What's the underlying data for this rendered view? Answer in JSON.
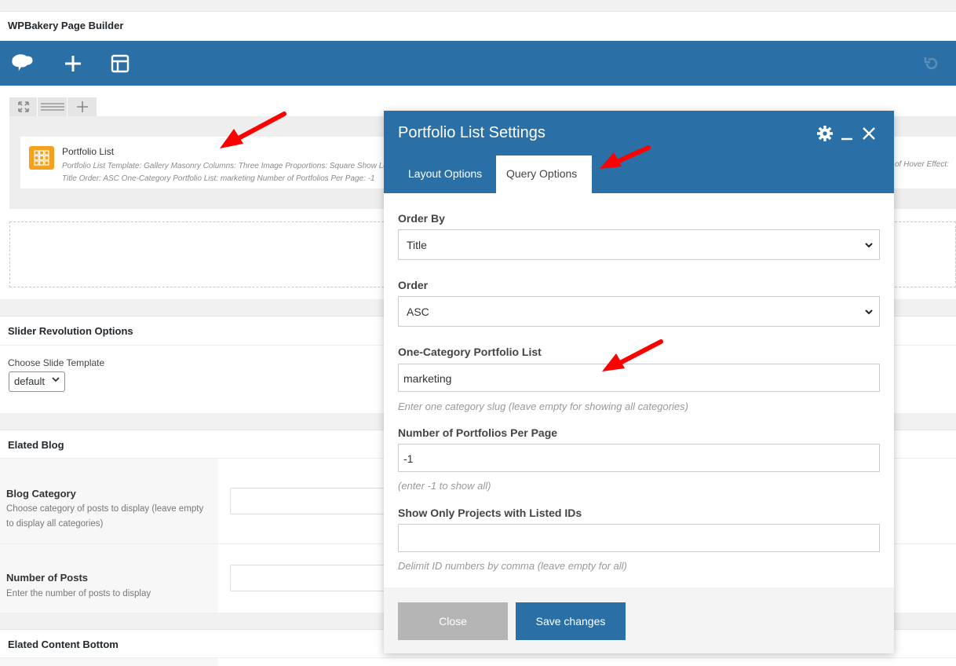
{
  "builder": {
    "title": "WPBakery Page Builder",
    "element": {
      "name": "Portfolio List",
      "desc_line1": "Portfolio List Template: Gallery  Masonry Columns: Three  Image Proportions: Square  Show Load More: No",
      "desc_line2": "Title  Order: ASC  One-Category Portfolio List: marketing  Number of Portfolios Per Page: -1",
      "desc_right": "of Hover Effect: "
    }
  },
  "slider_revolution": {
    "title": "Slider Revolution Options",
    "template_label": "Choose Slide Template",
    "template_value": "default"
  },
  "elated_blog": {
    "title": "Elated Blog",
    "blog_category_label": "Blog Category",
    "blog_category_desc": "Choose category of posts to display (leave empty to display all categories)",
    "number_posts_label": "Number of Posts",
    "number_posts_desc": "Enter the number of posts to display"
  },
  "elated_content_bottom": {
    "title": "Elated Content Bottom"
  },
  "modal": {
    "title": "Portfolio List Settings",
    "tabs": [
      "Layout Options",
      "Query Options"
    ],
    "active_tab": "Query Options",
    "fields": {
      "order_by_label": "Order By",
      "order_by_value": "Title",
      "order_label": "Order",
      "order_value": "ASC",
      "one_category_label": "One-Category Portfolio List",
      "one_category_value": "marketing",
      "one_category_help": "Enter one category slug (leave empty for showing all categories)",
      "per_page_label": "Number of Portfolios Per Page",
      "per_page_value": "-1",
      "per_page_help": "(enter -1 to show all)",
      "ids_label": "Show Only Projects with Listed IDs",
      "ids_value": "",
      "ids_help": "Delimit ID numbers by comma (leave empty for all)"
    },
    "close_label": "Close",
    "save_label": "Save changes"
  },
  "colors": {
    "toolbar_blue": "#2a70a6",
    "annotation_red": "#ff0000",
    "element_icon_orange": "#f5a11b"
  }
}
